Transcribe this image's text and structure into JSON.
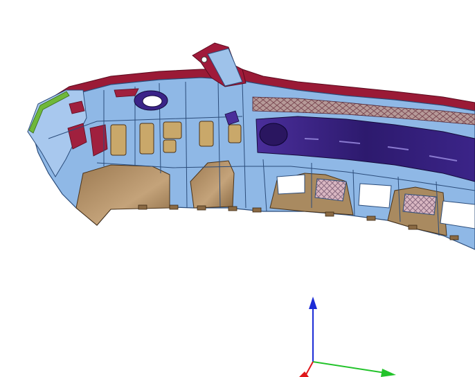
{
  "viewport": {
    "background_color": "#ffffff"
  },
  "model": {
    "colors": {
      "shell_outline": "#8a1530",
      "structure": "#8fb8e6",
      "structure_dark": "#5e87b8",
      "beige": "#b59468",
      "beige_dark": "#7a5a36",
      "purple": "#3a2480",
      "mesh": "#c4a2a0",
      "green_trim": "#6fb83a"
    }
  },
  "axis_triad": {
    "colors": {
      "x": "#22c32a",
      "y": "#1b2bd6",
      "z": "#e0161a"
    },
    "icons": [
      "x-axis-arrow",
      "y-axis-arrow",
      "z-axis-arrow"
    ]
  }
}
